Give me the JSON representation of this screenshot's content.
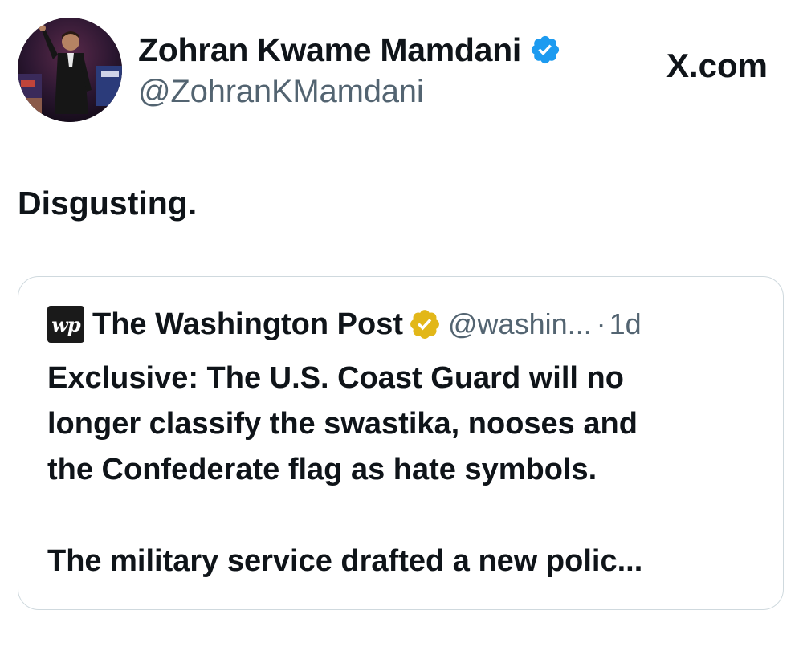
{
  "tweet": {
    "author": {
      "display_name": "Zohran Kwame Mamdani",
      "handle": "@ZohranKMamdani",
      "verified_badge_color": "#1d9bf0"
    },
    "site_label": "X.com",
    "text": "Disgusting.",
    "quoted": {
      "logo_text": "wp",
      "name": "The Washington Post",
      "verified_badge_color": "#e2b719",
      "handle": "@washin...",
      "separator": "·",
      "time": "1d",
      "body_lines": [
        "Exclusive: The U.S. Coast Guard will no",
        "longer classify the swastika, nooses and",
        "the Confederate flag as hate symbols."
      ],
      "body_continuation": "The military service drafted a new polic..."
    }
  }
}
